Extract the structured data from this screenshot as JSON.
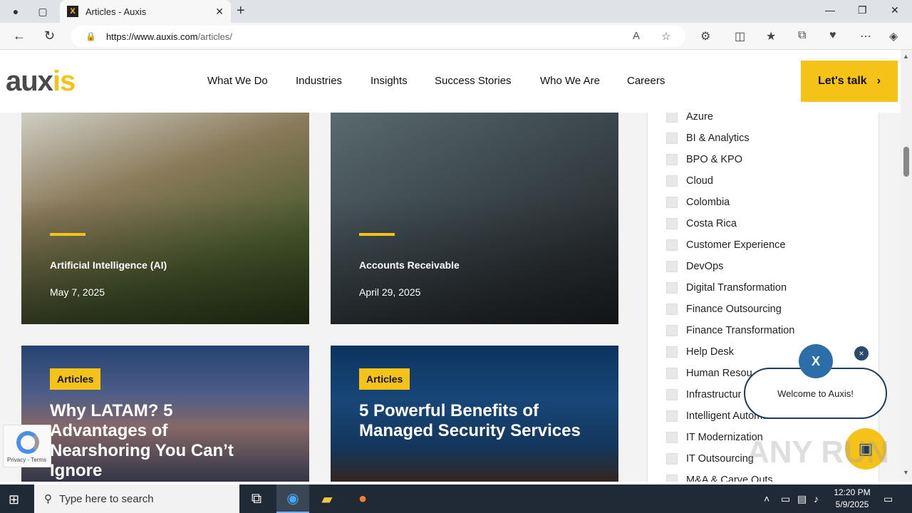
{
  "browser": {
    "tab_title": "Articles - Auxis",
    "favicon_letter": "X",
    "url_host": "https://www.auxis.com",
    "url_path": "/articles/"
  },
  "site": {
    "logo_part1": "aux",
    "logo_part2": "is",
    "nav": [
      "What We Do",
      "Industries",
      "Insights",
      "Success Stories",
      "Who We Are",
      "Careers"
    ],
    "cta": "Let's talk"
  },
  "cards": [
    {
      "category": "Artificial Intelligence (AI)",
      "date": "May 7, 2025"
    },
    {
      "category": "Accounts Receivable",
      "date": "April 29, 2025"
    },
    {
      "badge": "Articles",
      "headline": "Why LATAM? 5 Advantages of Nearshoring You Can’t Ignore"
    },
    {
      "badge": "Articles",
      "headline": "5 Powerful Benefits of Managed Security Services"
    }
  ],
  "filters": [
    "Azure",
    "BI & Analytics",
    "BPO & KPO",
    "Cloud",
    "Colombia",
    "Costa Rica",
    "Customer Experience",
    "DevOps",
    "Digital Transformation",
    "Finance Outsourcing",
    "Finance Transformation",
    "Help Desk",
    "Human Resou",
    "Infrastructur",
    "Intelligent Automation & RPA",
    "IT Modernization",
    "IT Outsourcing",
    "M&A & Carve Outs"
  ],
  "chat": {
    "welcome": "Welcome to Auxis!",
    "close": "×"
  },
  "recaptcha": {
    "text": "Privacy - Terms"
  },
  "watermark": "ANY RUN",
  "taskbar": {
    "search_placeholder": "Type here to search",
    "time": "12:20 PM",
    "date": "5/9/2025"
  },
  "colors": {
    "accent": "#f5c218",
    "dark": "#4a4a4a"
  }
}
